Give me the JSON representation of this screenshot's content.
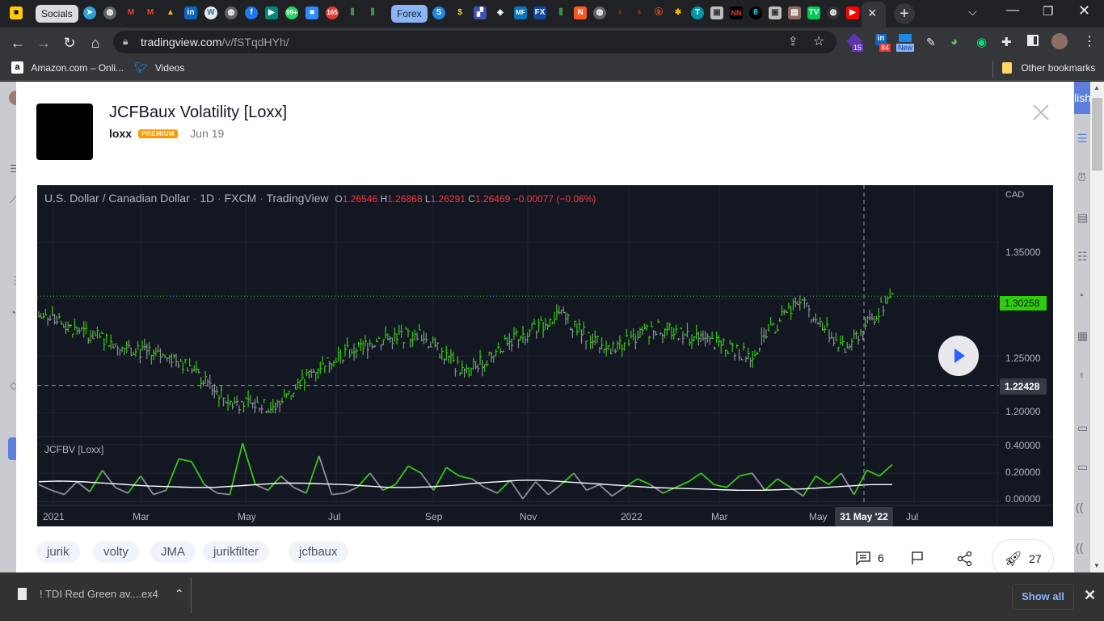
{
  "browser": {
    "tab_groups": [
      {
        "label": "Socials",
        "color": "#dadce0"
      },
      {
        "label": "Forex",
        "color": "#8ab4f8"
      }
    ],
    "active_tab_close": "×",
    "new_tab": "+",
    "url_domain": "tradingview.com",
    "url_path": "/v/fSTqdHYh/",
    "extension_badges": [
      "15",
      "84",
      "New"
    ],
    "bookmarks": [
      {
        "label": "Amazon.com – Onli...",
        "icon": "amazon-icon"
      },
      {
        "label": "Videos",
        "icon": "twitter-icon"
      }
    ],
    "other_bookmarks": "Other bookmarks"
  },
  "idea": {
    "title": "JCFBaux Volatility [Loxx]",
    "author": "loxx",
    "badge": "PREMIUM",
    "date": "Jun 19",
    "tags": [
      "jurik",
      "volty",
      "JMA",
      "jurikfilter",
      "jcfbaux"
    ],
    "comments_count": "6",
    "boosts_count": "27",
    "side_label": "lish"
  },
  "chart_header": {
    "symbol": "U.S. Dollar / Canadian Dollar",
    "interval": "1D",
    "exchange": "FXCM",
    "source": "TradingView",
    "o_label": "O",
    "o": "1.26546",
    "h_label": "H",
    "h": "1.26868",
    "l_label": "L",
    "l": "1.26291",
    "c_label": "C",
    "c": "1.26469",
    "change": "−0.00077 (−0.06%)"
  },
  "chart_data": {
    "type": "line",
    "title": "U.S. Dollar / Canadian Dollar · 1D · FXCM",
    "currency": "CAD",
    "price_axis_ticks": [
      "1.35000",
      "1.25000",
      "1.20000"
    ],
    "price_ylim": [
      1.18,
      1.4
    ],
    "last_price_label": "1.30258",
    "last_price": 1.30258,
    "crosshair_price_label": "1.22428",
    "crosshair_price": 1.22428,
    "crosshair_date_label": "31 May '22",
    "x_ticks": [
      "2021",
      "Mar",
      "May",
      "Jul",
      "Sep",
      "Nov",
      "2022",
      "Mar",
      "May",
      "Jul"
    ],
    "price_series_approx": [
      {
        "x": "2021-01",
        "y": 1.285
      },
      {
        "x": "2021-02",
        "y": 1.27
      },
      {
        "x": "2021-03",
        "y": 1.255
      },
      {
        "x": "2021-04",
        "y": 1.245
      },
      {
        "x": "2021-05",
        "y": 1.21
      },
      {
        "x": "2021-06",
        "y": 1.205
      },
      {
        "x": "2021-07",
        "y": 1.245
      },
      {
        "x": "2021-08",
        "y": 1.262
      },
      {
        "x": "2021-09",
        "y": 1.27
      },
      {
        "x": "2021-10",
        "y": 1.235
      },
      {
        "x": "2021-11",
        "y": 1.265
      },
      {
        "x": "2021-12",
        "y": 1.285
      },
      {
        "x": "2022-01",
        "y": 1.255
      },
      {
        "x": "2022-02",
        "y": 1.275
      },
      {
        "x": "2022-03",
        "y": 1.265
      },
      {
        "x": "2022-04",
        "y": 1.25
      },
      {
        "x": "2022-05",
        "y": 1.3
      },
      {
        "x": "2022-06",
        "y": 1.255
      },
      {
        "x": "2022-06-end",
        "y": 1.303
      }
    ],
    "indicator": {
      "name": "JCFBV [Loxx]",
      "ticks": [
        "0.40000",
        "0.20000",
        "0.00000"
      ],
      "ylim": [
        -0.02,
        0.45
      ],
      "series": [
        {
          "name": "JCFBV",
          "values": [
            0.12,
            0.08,
            0.05,
            0.14,
            0.07,
            0.22,
            0.1,
            0.06,
            0.18,
            0.05,
            0.08,
            0.3,
            0.28,
            0.12,
            0.06,
            0.05,
            0.41,
            0.12,
            0.08,
            0.18,
            0.1,
            0.06,
            0.32,
            0.05,
            0.06,
            0.1,
            0.2,
            0.08,
            0.12,
            0.25,
            0.2,
            0.08,
            0.24,
            0.18,
            0.16,
            0.1,
            0.06,
            0.15,
            0.02,
            0.14,
            0.05,
            0.12,
            0.2,
            0.08,
            0.12,
            0.04,
            0.1,
            0.16,
            0.12,
            0.06,
            0.1,
            0.14,
            0.2,
            0.12,
            0.1,
            0.18,
            0.2,
            0.08,
            0.16,
            0.1,
            0.04,
            0.18,
            0.12,
            0.2,
            0.05,
            0.22,
            0.18,
            0.26
          ]
        },
        {
          "name": "Signal",
          "values": [
            0.14,
            0.145,
            0.14,
            0.13,
            0.12,
            0.11,
            0.105,
            0.1,
            0.1,
            0.11,
            0.12,
            0.13,
            0.13,
            0.125,
            0.12,
            0.11,
            0.1,
            0.1,
            0.105,
            0.115,
            0.13,
            0.14,
            0.15,
            0.15,
            0.14,
            0.13,
            0.12,
            0.11,
            0.1,
            0.095,
            0.09,
            0.085,
            0.08,
            0.08,
            0.085,
            0.09,
            0.1,
            0.11,
            0.12,
            0.12
          ]
        }
      ]
    }
  }
}
